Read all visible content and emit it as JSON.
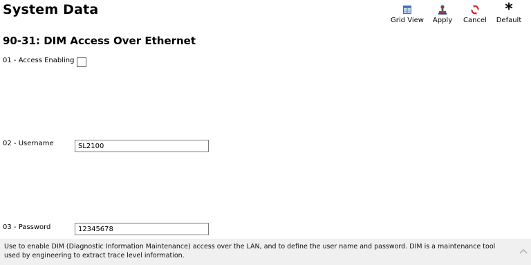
{
  "header": {
    "title": "System Data"
  },
  "toolbar": {
    "grid_view": "Grid View",
    "apply": "Apply",
    "cancel": "Cancel",
    "default": "Default"
  },
  "section": {
    "title": "90-31: DIM Access Over Ethernet"
  },
  "fields": {
    "access": {
      "label": "01 - Access Enabling",
      "checked": false
    },
    "username": {
      "label": "02 - Username",
      "value": "SL2100"
    },
    "password": {
      "label": "03 - Password",
      "value": "12345678"
    }
  },
  "help": {
    "text": "Use to enable DIM (Diagnostic Information Maintenance) access over the LAN, and to define the user name and password. DIM is a maintenance tool used by engineering to extract trace level information."
  },
  "icons": {
    "grid_view": "grid-icon",
    "apply": "stamp-icon",
    "cancel": "cancel-arrows-icon",
    "default": "asterisk-icon",
    "scroll": "chevron-up-icon"
  },
  "colors": {
    "help_bg": "#f0f0f0",
    "cancel_red": "#d0201a",
    "grid_blue": "#3a6fb5"
  }
}
